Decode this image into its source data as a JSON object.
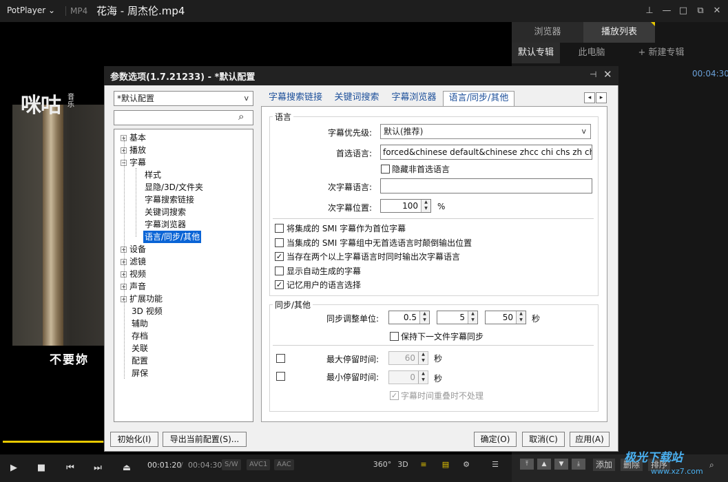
{
  "app": {
    "brand": "PotPlayer",
    "brand_arrow": "⌄",
    "format": "MP4",
    "filename": "花海 - 周杰伦.mp4"
  },
  "window_controls": {
    "pin": "⊥",
    "min": "—",
    "max": "□",
    "restore": "⧉",
    "close": "✕"
  },
  "video": {
    "logo": "咪咕",
    "logo_small": "音乐",
    "subtitle": "不要妳"
  },
  "seek": {
    "progress": 0.197
  },
  "playlist": {
    "tabs": [
      "浏览器",
      "播放列表"
    ],
    "subtabs": [
      "默认专辑",
      "此电脑",
      "+ 新建专辑"
    ],
    "item_time": "00:04:30"
  },
  "controls": {
    "play": "▶",
    "stop": "■",
    "prev": "⏮",
    "next": "⏭",
    "eject": "⏏",
    "time_current": "00:01:20",
    "time_sep": "/",
    "time_total": "00:04:30",
    "tags": [
      "S/W",
      "AVC1",
      "AAC"
    ],
    "icons": {
      "vr": "360°",
      "three_d": "3D",
      "sub_list": "≡",
      "subtitle": "▤",
      "settings": "⚙",
      "menu": "☰"
    }
  },
  "playlist_buttons": {
    "up_top": "⤒",
    "up": "▲",
    "down": "▼",
    "down_bottom": "⤓",
    "add": "添加",
    "delete": "删除",
    "sort": "排序",
    "search": "⌕"
  },
  "watermark": {
    "text": "极光下载站",
    "url": "www.xz7.com"
  },
  "dialog": {
    "title": "参数选项(1.7.21233) - *默认配置",
    "pin": "⊣",
    "close": "✕",
    "preset": "*默认配置",
    "combo_arrow": "v",
    "search_placeholder": "",
    "search_icon": "⌕",
    "tree": {
      "top": [
        "基本",
        "播放",
        "字幕"
      ],
      "subtitle_children": [
        "样式",
        "显隐/3D/文件夹",
        "字幕搜索链接",
        "关键词搜索",
        "字幕浏览器",
        "语言/同步/其他"
      ],
      "rest_expand": [
        "设备",
        "滤镜",
        "视频",
        "声音",
        "扩展功能"
      ],
      "rest_plain": [
        "3D 视频",
        "辅助",
        "存档",
        "关联",
        "配置",
        "屏保"
      ],
      "plus": "+",
      "minus": "−"
    },
    "tabs": [
      "字幕搜索链接",
      "关键词搜索",
      "字幕浏览器",
      "语言/同步/其他"
    ],
    "tab_scroll": {
      "left": "◂",
      "right": "▸"
    },
    "language_group": {
      "title": "语言",
      "priority_label": "字幕优先级:",
      "priority_value": "默认(推荐)",
      "preferred_label": "首选语言:",
      "preferred_value": "forced&chinese default&chinese zhcc chi chs zh chinese",
      "hide_nonpreferred": "隐藏非首选语言",
      "secondary_label": "次字幕语言:",
      "secondary_value": "",
      "position_label": "次字幕位置:",
      "position_value": "100",
      "position_unit": "%",
      "options": [
        {
          "label": "将集成的 SMI 字幕作为首位字幕",
          "checked": false
        },
        {
          "label": "当集成的 SMI 字幕组中无首选语言时颠倒输出位置",
          "checked": false
        },
        {
          "label": "当存在两个以上字幕语言时同时输出次字幕语言",
          "checked": true
        },
        {
          "label": "显示自动生成的字幕",
          "checked": false
        },
        {
          "label": "记忆用户的语言选择",
          "checked": true
        }
      ]
    },
    "sync_group": {
      "title": "同步/其他",
      "unit_label": "同步调整单位:",
      "unit_values": [
        "0.5",
        "5",
        "50"
      ],
      "unit_suffix": "秒",
      "keep_sync": "保持下一文件字幕同步",
      "max_label": "最大停留时间:",
      "max_value": "60",
      "max_unit": "秒",
      "min_label": "最小停留时间:",
      "min_value": "0",
      "min_unit": "秒",
      "overlap": "字幕时间重叠时不处理"
    },
    "buttons": {
      "init": "初始化(I)",
      "export": "导出当前配置(S)...",
      "ok": "确定(O)",
      "cancel": "取消(C)",
      "apply": "应用(A)"
    },
    "check_mark": "✓"
  }
}
